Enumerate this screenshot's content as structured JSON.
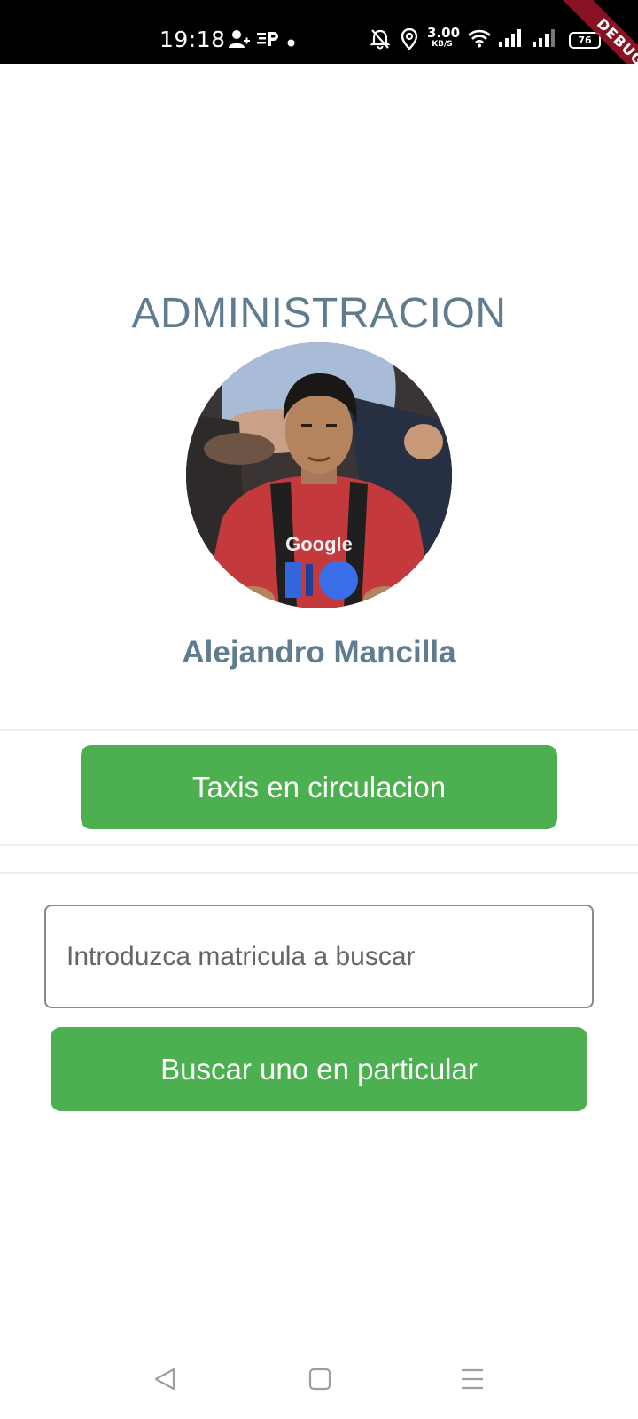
{
  "status_bar": {
    "time": "19:18",
    "net_speed_value": "3.00",
    "net_speed_unit": "KB/S",
    "battery": "76",
    "icons": [
      "add-contact-icon",
      "parking-icon",
      "dot-icon",
      "bell-off-icon",
      "location-icon",
      "wifi-icon",
      "signal-icon",
      "signal-icon",
      "battery-icon"
    ]
  },
  "debug_banner": "DEBUG",
  "page": {
    "title": "ADMINISTRACION",
    "user_name": "Alejandro Mancilla"
  },
  "actions": {
    "taxis_button": "Taxis en circulacion",
    "search_placeholder": "Introduzca matricula a buscar",
    "search_button": "Buscar uno en particular"
  },
  "nav_bar": {
    "icons": [
      "back-icon",
      "home-icon",
      "menu-icon"
    ]
  },
  "colors": {
    "accent_green": "#4caf50",
    "title_text": "#5f7d8f",
    "status_bar_bg": "#000000",
    "debug_banner": "#a01428"
  }
}
